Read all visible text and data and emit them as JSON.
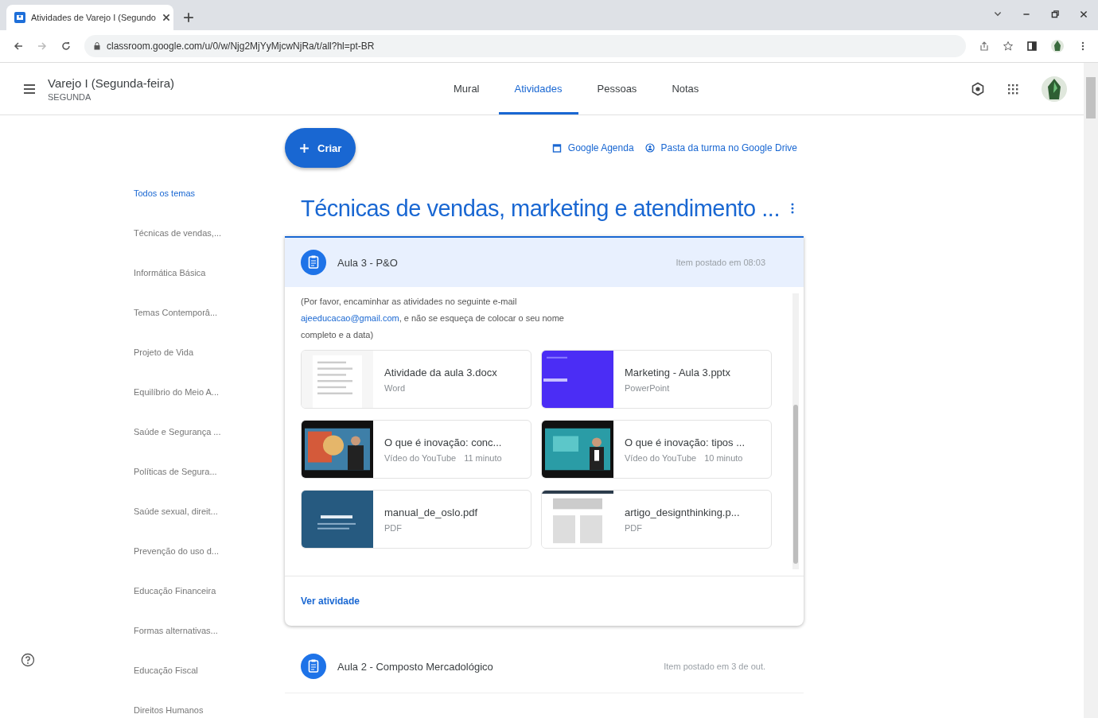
{
  "browser": {
    "tab_title": "Atividades de Varejo I (Segundo",
    "url": "classroom.google.com/u/0/w/Njg2MjYyMjcwNjRa/t/all?hl=pt-BR"
  },
  "header": {
    "course": "Varejo I (Segunda-feira)",
    "section": "SEGUNDA"
  },
  "tabs": [
    {
      "label": "Mural",
      "selected": false
    },
    {
      "label": "Atividades",
      "selected": true
    },
    {
      "label": "Pessoas",
      "selected": false
    },
    {
      "label": "Notas",
      "selected": false
    }
  ],
  "create_button": "Criar",
  "links": [
    {
      "kind": "calendar",
      "label": "Google Agenda"
    },
    {
      "kind": "drive",
      "label": "Pasta da turma no Google Drive"
    }
  ],
  "sidebar": {
    "items": [
      {
        "label": "Todos os temas",
        "selected": true
      },
      {
        "label": "Técnicas de vendas,...",
        "selected": false
      },
      {
        "label": "Informática Básica",
        "selected": false
      },
      {
        "label": "Temas Contemporâ...",
        "selected": false
      },
      {
        "label": "Projeto de Vida",
        "selected": false
      },
      {
        "label": "Equilíbrio do Meio A...",
        "selected": false
      },
      {
        "label": "Saúde e Segurança ...",
        "selected": false
      },
      {
        "label": "Políticas de Segura...",
        "selected": false
      },
      {
        "label": "Saúde sexual, direit...",
        "selected": false
      },
      {
        "label": "Prevenção do uso d...",
        "selected": false
      },
      {
        "label": "Educação Financeira",
        "selected": false
      },
      {
        "label": "Formas alternativas...",
        "selected": false
      },
      {
        "label": "Educação Fiscal",
        "selected": false
      },
      {
        "label": "Direitos Humanos",
        "selected": false
      }
    ]
  },
  "topic": {
    "title": "Técnicas de vendas, marketing e atendimento ...",
    "assignments": [
      {
        "title": "Aula 3 - P&O",
        "posted": "Item postado em 08:03",
        "expanded": true,
        "description": {
          "before": "(Por favor, encaminhar as atividades no seguinte e-mail ",
          "link": "ajeeducacao@gmail.com",
          "after": ", e não se esqueça de colocar o seu nome completo e a data)"
        },
        "materials": [
          {
            "kind": "doc",
            "name": "Atividade da aula 3.docx",
            "meta": [
              "Word"
            ]
          },
          {
            "kind": "slides",
            "name": "Marketing - Aula 3.pptx",
            "meta": [
              "PowerPoint"
            ]
          },
          {
            "kind": "video",
            "name": "O que é inovação: conc...",
            "meta": [
              "Vídeo do YouTube",
              "11 minuto"
            ]
          },
          {
            "kind": "video2",
            "name": "O que é inovação: tipos ...",
            "meta": [
              "Vídeo do YouTube",
              "10 minuto"
            ]
          },
          {
            "kind": "cover",
            "name": "manual_de_oslo.pdf",
            "meta": [
              "PDF"
            ]
          },
          {
            "kind": "page",
            "name": "artigo_designthinking.p...",
            "meta": [
              "PDF"
            ]
          }
        ],
        "action": "Ver atividade"
      },
      {
        "title": "Aula 2 - Composto Mercadológico",
        "posted": "Item postado em 3 de out.",
        "expanded": false
      }
    ]
  }
}
